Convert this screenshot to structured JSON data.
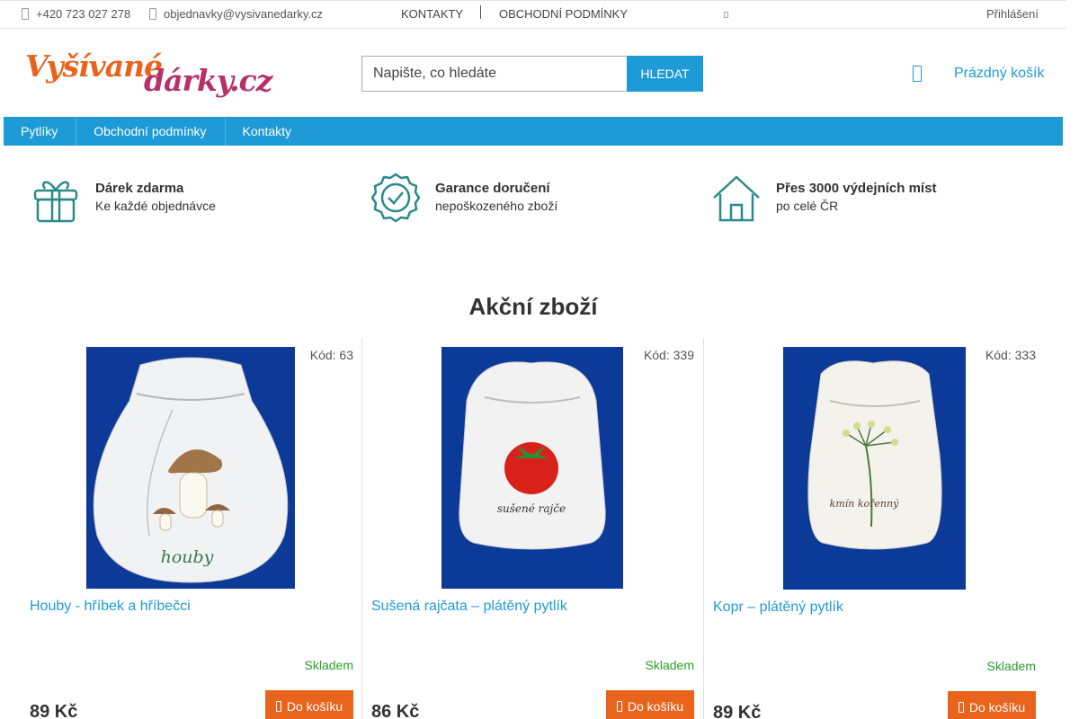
{
  "topbar": {
    "phone": "+420 723 027 278",
    "email": "objednavky@vysivanedarky.cz",
    "links": [
      "KONTAKTY",
      "OBCHODNÍ PODMÍNKY"
    ],
    "login": "Přihlášení"
  },
  "header": {
    "logo_part1": "Vyšívané",
    "logo_part2": "dárky.cz",
    "search_placeholder": "Napište, co hledáte",
    "search_button": "HLEDAT",
    "cart_label": "Prázdný košík"
  },
  "nav": {
    "items": [
      "Pytlíky",
      "Obchodní podmínky",
      "Kontakty"
    ]
  },
  "benefits": [
    {
      "title": "Dárek zdarma",
      "subtitle": "Ke každé objednávce",
      "icon": "gift-icon"
    },
    {
      "title": "Garance doručení",
      "subtitle": "nepoškozeného zboží",
      "icon": "badge-check-icon"
    },
    {
      "title": "Přes 3000 výdejních míst",
      "subtitle": "po celé ČR",
      "icon": "house-icon"
    }
  ],
  "section_title": "Akční zboží",
  "products": [
    {
      "code": "Kód: 63",
      "name": "Houby - hříbek a hříbečci",
      "stock": "Skladem",
      "price": "89 Kč",
      "button": "Do košíku",
      "embroidery": "houby"
    },
    {
      "code": "Kód: 339",
      "name": "Sušená rajčata – plátěný pytlík",
      "stock": "Skladem",
      "price": "86 Kč",
      "button": "Do košíku",
      "embroidery": "sušené rajče"
    },
    {
      "code": "Kód: 333",
      "name": "Kopr – plátěný pytlík",
      "stock": "Skladem",
      "price": "89 Kč",
      "button": "Do košíku",
      "embroidery": "kmín kořenný"
    }
  ],
  "colors": {
    "accent": "#1e9bd7",
    "cta": "#e8641c",
    "stock": "#2a9d2a",
    "icon": "#2a8a8a"
  }
}
